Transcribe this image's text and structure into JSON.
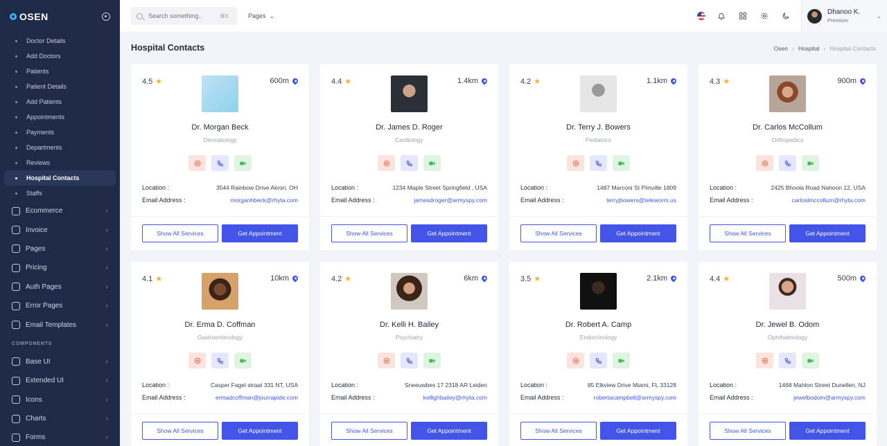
{
  "brand": {
    "name": "OSEN"
  },
  "sidebar": {
    "subitems": [
      {
        "label": "Doctor Details",
        "active": false
      },
      {
        "label": "Add Doctors",
        "active": false
      },
      {
        "label": "Patients",
        "active": false
      },
      {
        "label": "Patient Details",
        "active": false
      },
      {
        "label": "Add Patients",
        "active": false
      },
      {
        "label": "Appointments",
        "active": false
      },
      {
        "label": "Payments",
        "active": false
      },
      {
        "label": "Departments",
        "active": false
      },
      {
        "label": "Reviews",
        "active": false
      },
      {
        "label": "Hospital Contacts",
        "active": true
      },
      {
        "label": "Staffs",
        "active": false
      }
    ],
    "items": [
      {
        "label": "Ecommerce",
        "icon": "cart-icon"
      },
      {
        "label": "Invoice",
        "icon": "invoice-icon"
      },
      {
        "label": "Pages",
        "icon": "pages-icon"
      },
      {
        "label": "Pricing",
        "icon": "pricing-icon"
      },
      {
        "label": "Auth Pages",
        "icon": "lock-icon"
      },
      {
        "label": "Error Pages",
        "icon": "error-icon"
      },
      {
        "label": "Email Templates",
        "icon": "email-icon"
      }
    ],
    "components_title": "COMPONENTS",
    "components": [
      {
        "label": "Base UI",
        "icon": "base-ui-icon"
      },
      {
        "label": "Extended UI",
        "icon": "extended-ui-icon"
      },
      {
        "label": "Icons",
        "icon": "icons-icon"
      },
      {
        "label": "Charts",
        "icon": "charts-icon"
      },
      {
        "label": "Forms",
        "icon": "forms-icon"
      }
    ]
  },
  "topbar": {
    "search_placeholder": "Search something..",
    "search_shortcut": "⌘K",
    "pages_menu": "Pages",
    "user": {
      "name": "Dhanoo K.",
      "role": "Premium"
    }
  },
  "page": {
    "title": "Hospital Contacts",
    "breadcrumb": [
      "Osen",
      "Hospital",
      "Hospital Contacts"
    ]
  },
  "labels": {
    "location": "Location :",
    "email": "Email Address :",
    "show_services": "Show All Services",
    "get_appointment": "Get Appointment"
  },
  "doctors": [
    {
      "rating": "4.5",
      "distance": "600m",
      "name": "Dr. Morgan Beck",
      "specialty": "Dermatology",
      "location": "3544 Rainbow Drive Akron, OH",
      "email": "morganhbeck@rhyta.com",
      "photo": "illustration"
    },
    {
      "rating": "4.4",
      "distance": "1.4km",
      "name": "Dr. James D. Roger",
      "specialty": "Cardiology",
      "location": "1234 Maple Street Springfield , USA",
      "email": "jamesdroger@armyspy.com",
      "photo": "dark"
    },
    {
      "rating": "4.2",
      "distance": "1.1km",
      "name": "Dr. Terry J. Bowers",
      "specialty": "Pediatrics",
      "location": "1487 Marconi St Pimville 1809",
      "email": "terryjbowers@teleworm.us",
      "photo": "grey"
    },
    {
      "rating": "4.3",
      "distance": "900m",
      "name": "Dr. Carlos McCollum",
      "specialty": "Orthopedics",
      "location": "2425 Bhoola Road Nahoon 12, USA",
      "email": "carloslmccollum@rhyta.com",
      "photo": "curly"
    },
    {
      "rating": "4.1",
      "distance": "10km",
      "name": "Dr. Erma D. Coffman",
      "specialty": "Gastroenterology",
      "location": "Casper Fagel straat 331 NT, USA",
      "email": "ermadcoffman@jourrapide.com",
      "photo": "warm"
    },
    {
      "rating": "4.2",
      "distance": "6km",
      "name": "Dr. Kelli H. Bailey",
      "specialty": "Psychiatry",
      "location": "Sneeuwbes 17 2318 AR Leiden",
      "email": "kellighbailey@rhyta.com",
      "photo": "hair"
    },
    {
      "rating": "3.5",
      "distance": "2.1km",
      "name": "Dr. Robert A. Camp",
      "specialty": "Endocrinology",
      "location": "85 Elkview Drive Miami, FL 33128",
      "email": "robertacampbell@armyspy.com",
      "photo": "night"
    },
    {
      "rating": "4.4",
      "distance": "500m",
      "name": "Dr. Jewel B. Odom",
      "specialty": "Ophthalmology",
      "location": "1468 Mahlon Street Dunellen, NJ",
      "email": "jewelbodom@armyspy.com",
      "photo": "colorful"
    }
  ],
  "colors": {
    "primary": "#4255e8",
    "sidebar": "#1f2a48",
    "star": "#f5b324"
  }
}
